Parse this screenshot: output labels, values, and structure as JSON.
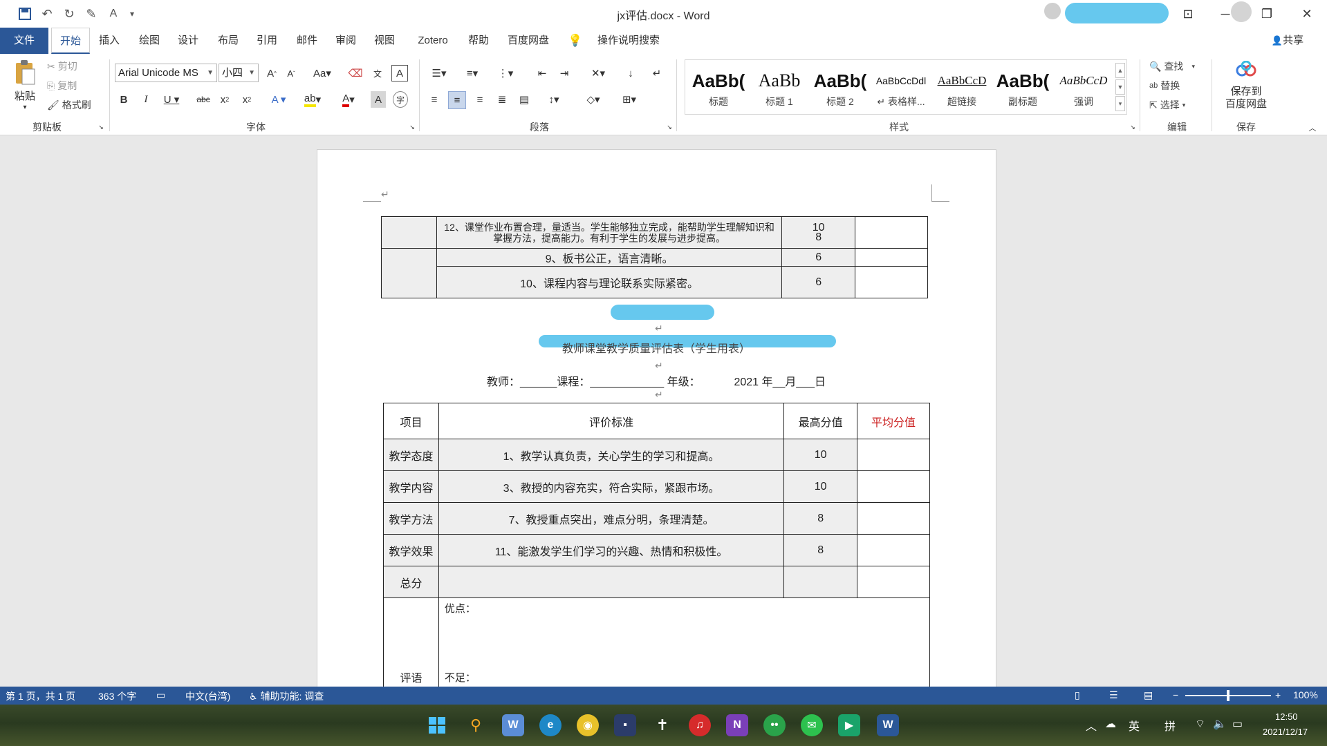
{
  "titlebar": {
    "title": "jx评估.docx  -  Word",
    "quick_access": [
      "save-icon",
      "undo-icon",
      "redo-icon",
      "touch-mode-icon",
      "read-aloud-icon",
      "customize-qat-icon"
    ]
  },
  "ribbon_tabs": [
    "文件",
    "开始",
    "插入",
    "绘图",
    "设计",
    "布局",
    "引用",
    "邮件",
    "审阅",
    "视图",
    "Zotero",
    "帮助",
    "百度网盘"
  ],
  "active_tab": "开始",
  "tell_me": "操作说明搜索",
  "share_label": "共享",
  "clipboard": {
    "paste": "粘贴",
    "cut": "剪切",
    "copy": "复制",
    "format_painter": "格式刷",
    "group_label": "剪贴板"
  },
  "font": {
    "font_name": "Arial Unicode MS",
    "font_size": "小四",
    "group_label": "字体"
  },
  "paragraph": {
    "group_label": "段落"
  },
  "styles": {
    "items": [
      {
        "sample": "AaBb(",
        "name": "标题"
      },
      {
        "sample": "AaBb",
        "name": "标题 1"
      },
      {
        "sample": "AaBb(",
        "name": "标题 2"
      },
      {
        "sample": "AaBbCcDdl",
        "name": "↵ 表格样..."
      },
      {
        "sample": "AaBbCcD",
        "name": "超链接"
      },
      {
        "sample": "AaBb(",
        "name": "副标题"
      },
      {
        "sample": "AaBbCcD",
        "name": "强调"
      }
    ],
    "group_label": "样式"
  },
  "editing": {
    "find": "查找",
    "replace": "替换",
    "select": "选择",
    "group_label": "编辑"
  },
  "baidu": {
    "save_label_1": "保存到",
    "save_label_2": "百度网盘",
    "group_label": "保存"
  },
  "document": {
    "top_table": {
      "rows": [
        {
          "criteria": "12、课堂作业布置合理，量适当。学生能够独立完成，能帮助学生理解知识和掌握方法，提高能力。有利于学生的发展与进步提高。",
          "score": "10",
          "score2": "8"
        },
        {
          "criteria": "9、板书公正，语言清晰。",
          "score": "6"
        },
        {
          "criteria": "10、课程内容与理论联系实际紧密。",
          "score": "6"
        }
      ]
    },
    "title_line": "教师课堂教学质量评估表（学生用表）",
    "header_line": {
      "teacher": "教师：______课程：____________ 年级：",
      "date": "2021 年__月___日"
    },
    "main_table": {
      "headers": [
        "项目",
        "评价标准",
        "最高分值",
        "平均分值"
      ],
      "rows": [
        {
          "item": "教学态度",
          "criteria": "1、教学认真负责，关心学生的学习和提高。",
          "max": "10"
        },
        {
          "item": "教学内容",
          "criteria": "3、教授的内容充实，符合实际，紧跟市场。",
          "max": "10"
        },
        {
          "item": "教学方法",
          "criteria": "7、教授重点突出，难点分明，条理清楚。",
          "max": "8"
        },
        {
          "item": "教学效果",
          "criteria": "11、能激发学生们学习的兴趣、热情和积极性。",
          "max": "8"
        }
      ],
      "total_label": "总分",
      "comment_label": "评语",
      "comment_good": "优点：",
      "comment_bad": "不足："
    }
  },
  "statusbar": {
    "page": "第 1 页，共 1 页",
    "words": "363 个字",
    "language": "中文(台湾)",
    "accessibility": "辅助功能: 调查",
    "zoom": "100%"
  },
  "taskbar": {
    "apps": [
      "start-icon",
      "search-icon",
      "word-viewer-icon",
      "edge-icon",
      "chrome-icon",
      "app-icon",
      "pin-icon",
      "netease-music-icon",
      "onenote-icon",
      "app-green-icon",
      "wechat-icon",
      "app-triangle-icon",
      "word-icon"
    ],
    "ime_lang": "英",
    "ime_mode": "拼",
    "time": "12:50",
    "date": "2021/12/17"
  },
  "colors": {
    "brand": "#2b5797",
    "status_bar": "#2b5797",
    "red_text": "#cc2222",
    "redaction": "#66c8ee"
  }
}
